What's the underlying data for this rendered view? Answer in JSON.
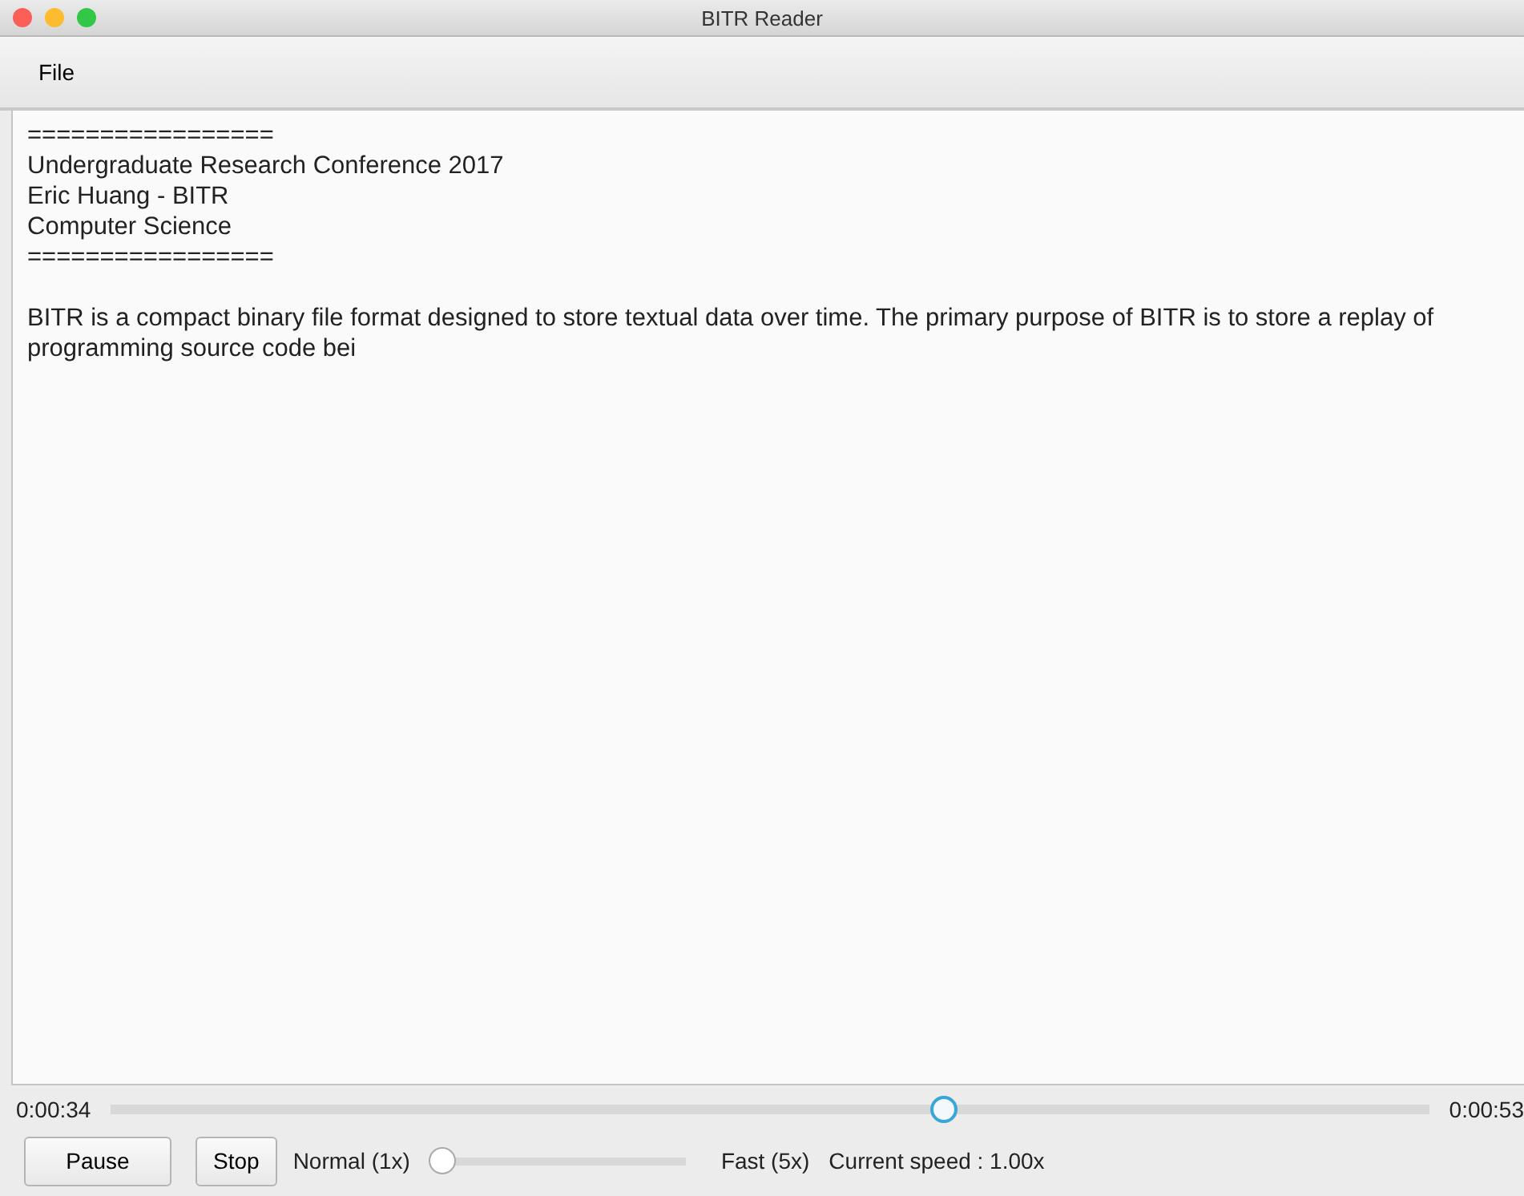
{
  "window": {
    "title": "BITR Reader"
  },
  "menu": [
    "File"
  ],
  "document": {
    "header_lines": [
      "=================",
      "Undergraduate Research Conference 2017",
      "Eric Huang - BITR",
      "Computer Science",
      "================="
    ],
    "body": "BITR is a compact binary file format designed to store textual data over time. The primary purpose of BITR is to store a replay of programming source code bei"
  },
  "timeline": {
    "elapsed": "0:00:34",
    "total": "0:00:53",
    "level": 0.634
  },
  "controls": {
    "buttons": [
      "Pause",
      "Stop"
    ],
    "speed_min_label": "Normal (1x)",
    "speed_slider": {
      "level": 0
    },
    "speed_max_label": "Fast (5x)",
    "current_speed": "Current speed : 1.00x"
  }
}
